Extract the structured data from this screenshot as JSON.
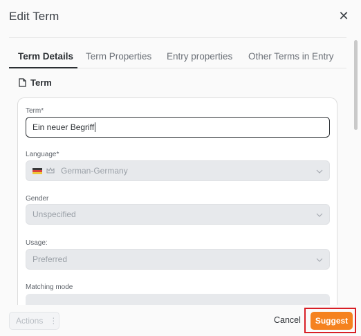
{
  "dialog": {
    "title": "Edit Term",
    "close_icon": "close-icon"
  },
  "tabs": [
    {
      "label": "Term Details",
      "active": true
    },
    {
      "label": "Term Properties",
      "active": false
    },
    {
      "label": "Entry properties",
      "active": false
    },
    {
      "label": "Other Terms in Entry",
      "active": false
    }
  ],
  "section": {
    "icon": "document-icon",
    "title": "Term"
  },
  "fields": {
    "term": {
      "label": "Term*",
      "value": "Ein neuer Begriff"
    },
    "language": {
      "label": "Language*",
      "value": "German-Germany",
      "flag_icon": "german-flag-icon",
      "icon": "crown-icon"
    },
    "gender": {
      "label": "Gender",
      "value": "Unspecified"
    },
    "usage": {
      "label": "Usage:",
      "value": "Preferred"
    },
    "matching_mode": {
      "label": "Matching mode"
    }
  },
  "footer": {
    "actions_label": "Actions",
    "cancel_label": "Cancel",
    "suggest_label": "Suggest"
  },
  "colors": {
    "accent": "#f5821f",
    "highlight_border": "#d81f26",
    "disabled_field": "#e7e9ec"
  }
}
